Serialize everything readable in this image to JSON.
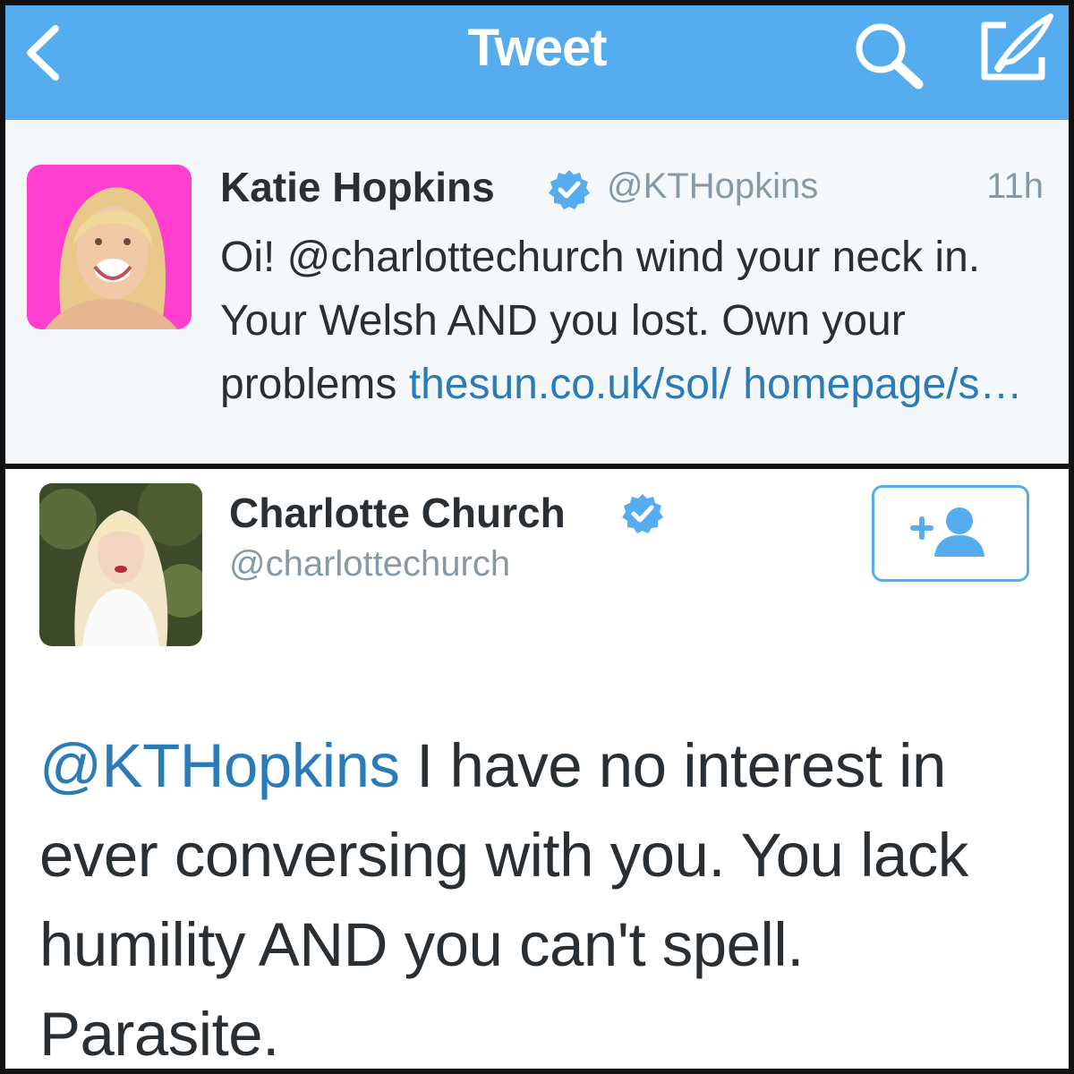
{
  "nav": {
    "title": "Tweet",
    "back_icon": "chevron-left-icon",
    "search_icon": "search-icon",
    "compose_icon": "compose-icon",
    "bar_color": "#55acee"
  },
  "tweet1": {
    "name": "Katie Hopkins",
    "handle": "@KTHopkins",
    "time": "11h",
    "verified": true,
    "body_text": "Oi! @charlottechurch wind your neck in. Your Welsh AND you lost. Own your problems ",
    "link_text": "thesun.co.uk/sol/ homepage/s…",
    "avatar_bg": "#ff3fd0"
  },
  "tweet2": {
    "name": "Charlotte Church",
    "handle": "@charlottechurch",
    "verified": true,
    "follow_icon": "add-user-icon",
    "mention": "@KTHopkins",
    "body_text": " I have no interest in ever conversing with you. You lack humility AND you can't spell. Parasite."
  },
  "colors": {
    "link": "#2b7bb9",
    "verified": "#55acee",
    "text": "#292f33",
    "muted": "#8899a6"
  }
}
